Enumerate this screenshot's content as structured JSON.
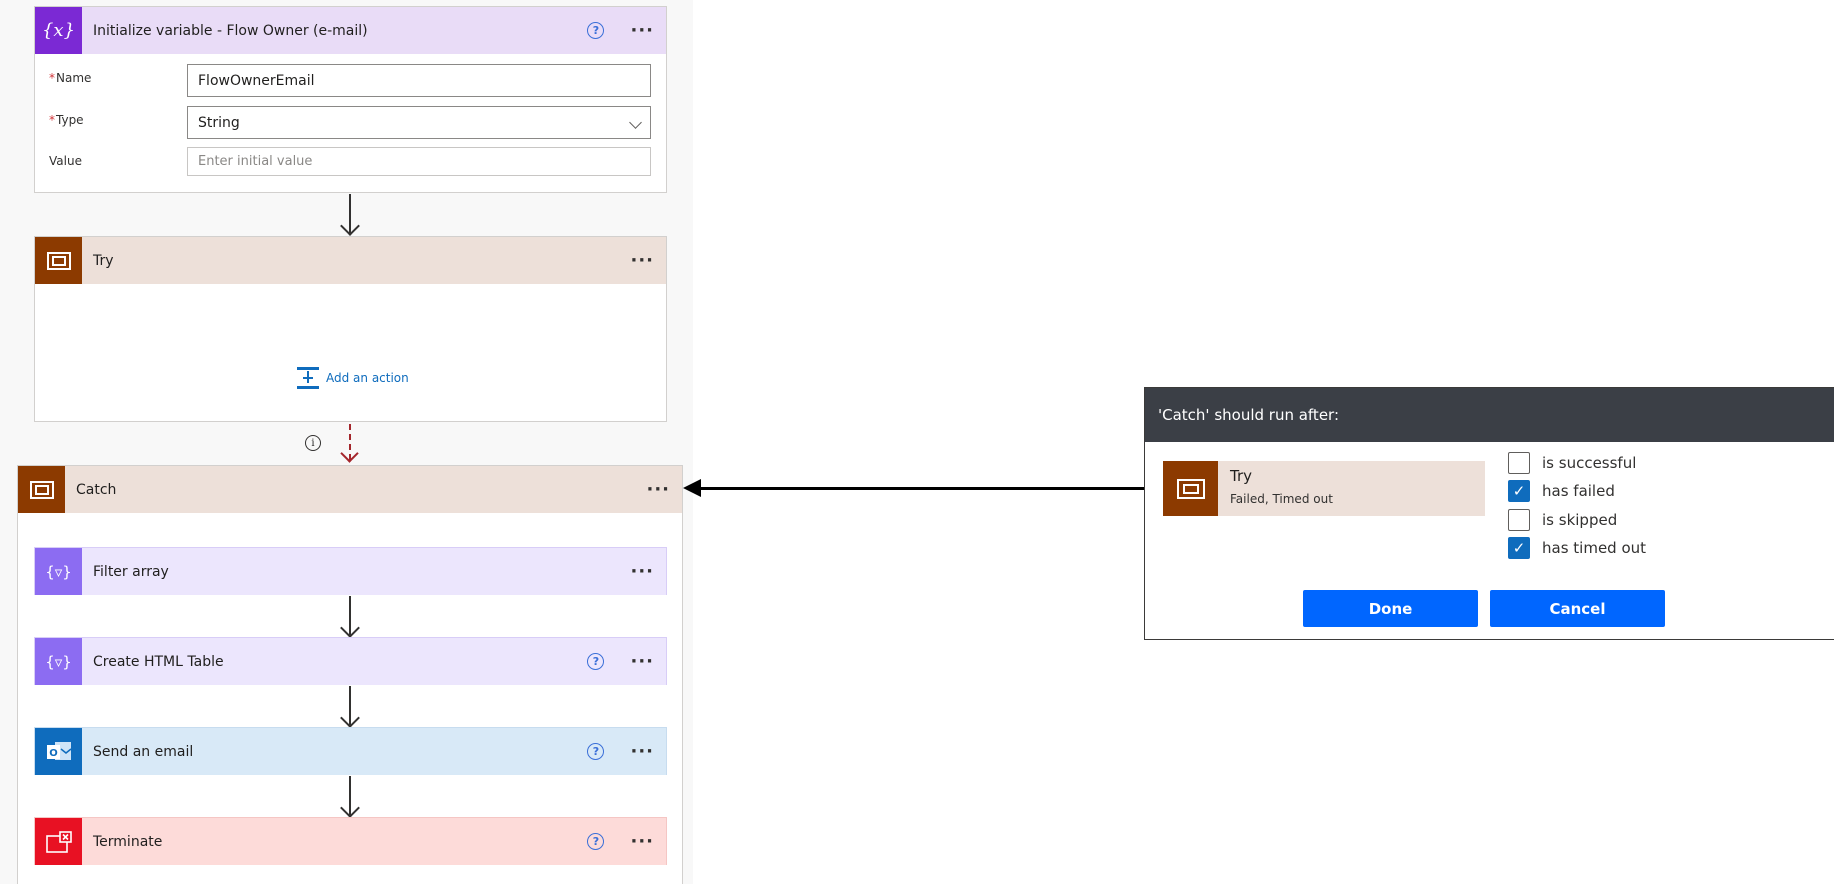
{
  "init_variable": {
    "title": "Initialize variable - Flow Owner (e-mail)",
    "name_label": "Name",
    "name_value": "FlowOwnerEmail",
    "type_label": "Type",
    "type_value": "String",
    "value_label": "Value",
    "value_placeholder": "Enter initial value",
    "icon": "curly-x-icon",
    "color": "#7b29d4"
  },
  "try_scope": {
    "title": "Try",
    "add_action_label": "Add an action",
    "icon": "scope-icon",
    "color": "#8c3a00"
  },
  "catch_scope": {
    "title": "Catch",
    "icon": "scope-icon",
    "color": "#8c3a00",
    "actions": [
      {
        "title": "Filter array",
        "icon": "filter-icon",
        "color": "#8c6cf2"
      },
      {
        "title": "Create HTML Table",
        "icon": "filter-icon",
        "color": "#8c6cf2"
      },
      {
        "title": "Send an email",
        "icon": "outlook-icon",
        "color": "#0f6cbd"
      },
      {
        "title": "Terminate",
        "icon": "terminate-icon",
        "color": "#e81123"
      }
    ]
  },
  "dialog": {
    "title": "'Catch' should run after:",
    "try_title": "Try",
    "try_subtitle": "Failed, Timed out",
    "options": [
      {
        "label": "is successful",
        "checked": false
      },
      {
        "label": "has failed",
        "checked": true
      },
      {
        "label": "is skipped",
        "checked": false
      },
      {
        "label": "has timed out",
        "checked": true
      }
    ],
    "done_label": "Done",
    "cancel_label": "Cancel",
    "accent": "#0066ff"
  }
}
